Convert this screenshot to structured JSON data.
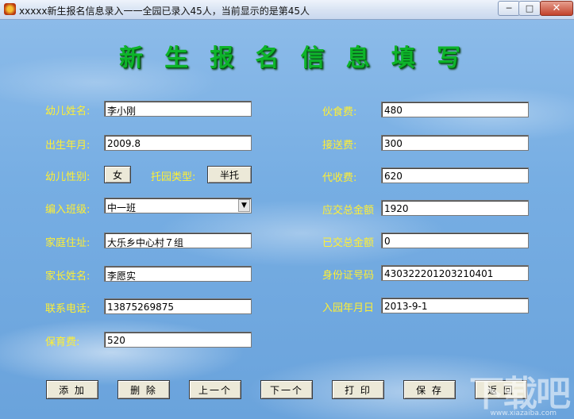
{
  "window": {
    "title": "xxxxx新生报名信息录入一一全园已录入45人，当前显示的是第45人",
    "min_label": "─",
    "max_label": "□",
    "close_label": "✕"
  },
  "heading": [
    "新",
    "生",
    "报",
    "名",
    "信",
    "息",
    "填",
    "写"
  ],
  "left_fields": {
    "name_label": "幼儿姓名:",
    "name_value": "李小刚",
    "birth_label": "出生年月:",
    "birth_value": "2009.8",
    "gender_label": "幼儿性别:",
    "gender_value": "女",
    "care_type_label": "托园类型:",
    "care_type_value": "半托",
    "class_label": "编入班级:",
    "class_value": "中一班",
    "address_label": "家庭住址:",
    "address_value": "大乐乡中心村７组",
    "parent_label": "家长姓名:",
    "parent_value": "李愿实",
    "phone_label": "联系电话:",
    "phone_value": "13875269875",
    "care_fee_label": "保育费:",
    "care_fee_value": "520"
  },
  "right_fields": {
    "meal_label": "伙食费:",
    "meal_value": "480",
    "transport_label": "接送费:",
    "transport_value": "300",
    "collect_label": "代收费:",
    "collect_value": "620",
    "total_due_label": "应交总金额",
    "total_due_value": "1920",
    "paid_label": "已交总金额",
    "paid_value": "0",
    "id_label": "身份证号码",
    "id_value": "430322201203210401",
    "enroll_label": "入园年月日",
    "enroll_value": "2013-9-1"
  },
  "buttons": {
    "add": "添 加",
    "delete": "删 除",
    "prev": "上一个",
    "next": "下一个",
    "print": "打 印",
    "save": "保 存",
    "back": "返 回"
  },
  "watermark": {
    "brand": "下载吧",
    "url": "www.xiazaiba.com"
  },
  "colors": {
    "label": "#ffef33",
    "heading": "#0eb42a",
    "background": "#6fa6de"
  }
}
